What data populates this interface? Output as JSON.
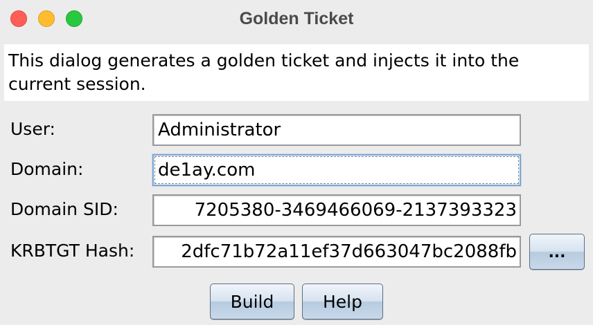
{
  "window": {
    "title": "Golden Ticket",
    "controls": {
      "close": "close-icon",
      "minimize": "minimize-icon",
      "maximize": "maximize-icon"
    }
  },
  "description": "This dialog generates a golden ticket and injects it into the current session.",
  "form": {
    "user": {
      "label": "User:",
      "value": "Administrator"
    },
    "domain": {
      "label": "Domain:",
      "value": "de1ay.com"
    },
    "domain_sid": {
      "label": "Domain SID:",
      "value": "7205380-3469466069-2137393323"
    },
    "krbtgt_hash": {
      "label": "KRBTGT Hash:",
      "value": "2dfc71b72a11ef37d663047bc2088fb",
      "browse_label": "..."
    }
  },
  "buttons": {
    "build": "Build",
    "help": "Help"
  },
  "colors": {
    "close": "#ff5f57",
    "minimize": "#febc2e",
    "maximize": "#28c840",
    "window_background": "#ececec",
    "focus_border": "#7ea6cf"
  }
}
